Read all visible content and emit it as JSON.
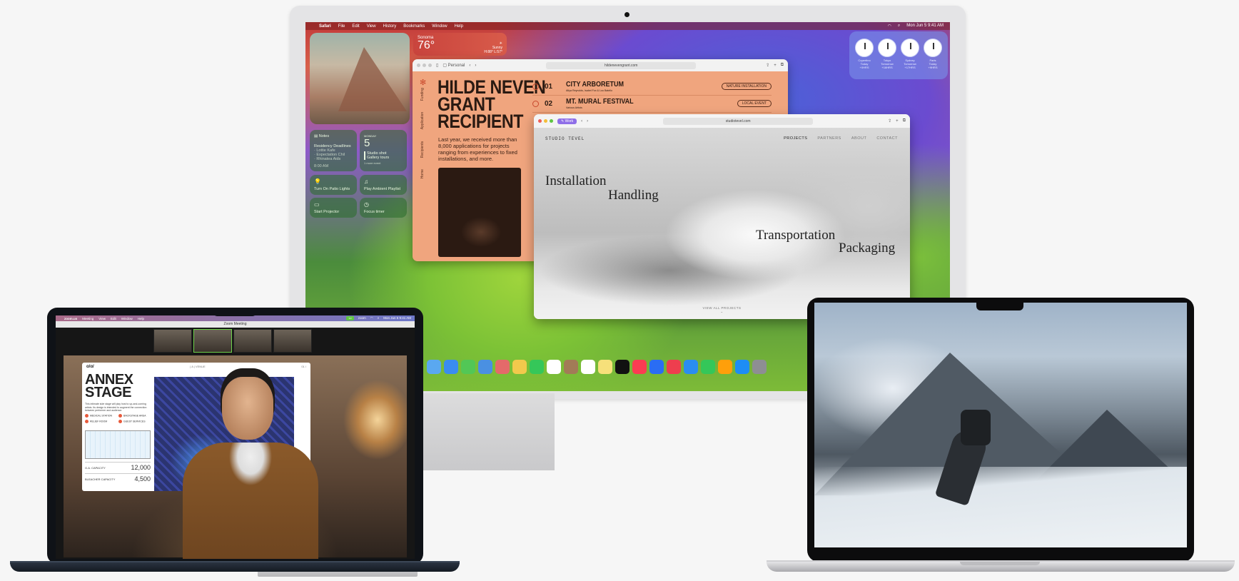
{
  "imac": {
    "menubar": {
      "apple": "",
      "app": "Safari",
      "items": [
        "File",
        "Edit",
        "View",
        "History",
        "Bookmarks",
        "Window",
        "Help"
      ],
      "clock": "Mon Jun 5  9:41 AM"
    },
    "weather": {
      "city": "Sonoma",
      "temp": "76°",
      "cond": "Sunny",
      "range": "H:88° L:57°"
    },
    "widgets": {
      "notes_title": "Notes",
      "notes_lines": [
        "Residency Deadlines",
        "· Lottie Kafe",
        "· Expectation Chil",
        "· Rhinatea Aids"
      ],
      "notes_time": "8:00 AM",
      "cal_day": "MONDAY",
      "cal_num": "5",
      "cal_events": [
        "Studio shot",
        "Gallery tours"
      ],
      "cal_more": "1 more event",
      "home": [
        "Turn On Patio Lights",
        "Play Ambient Playlist",
        "Start Projector",
        "Focus timer"
      ]
    },
    "clocks": [
      {
        "city": "Cupertino",
        "day": "Today",
        "offset": "+0HRS"
      },
      {
        "city": "Tokyo",
        "day": "Tomorrow",
        "offset": "+16HRS"
      },
      {
        "city": "Sydney",
        "day": "Tomorrow",
        "offset": "+17HRS"
      },
      {
        "city": "Paris",
        "day": "Today",
        "offset": "+9HRS"
      }
    ],
    "win1": {
      "profile": "Personal",
      "url": "hildenevengrant.com",
      "heading": [
        "HILDE NEVEN",
        "GRANT",
        "RECIPIENT"
      ],
      "side_tabs": [
        "Home",
        "Recipients",
        "Application",
        "Funding"
      ],
      "body": "Last year, we received more than 8,000 applications for projects ranging from experiences to fixed installations, and more.",
      "events": [
        {
          "num": "01",
          "title": "CITY ARBORETUM",
          "sub": "Atlya Reynolds, Isabel Fox & Lou Batello",
          "tag": "NATURE INSTALLATION"
        },
        {
          "num": "02",
          "title": "MT. MURAL FESTIVAL",
          "sub": "Various Artists",
          "tag": "LOCAL EVENT"
        }
      ]
    },
    "win2": {
      "profile": "Work",
      "url": "studiotevel.com",
      "logo": "STUDIO TEVEL",
      "nav": [
        "PROJECTS",
        "PARTNERS",
        "ABOUT",
        "CONTACT"
      ],
      "words": [
        "Installation",
        "Handling",
        "Transportation",
        "Packaging"
      ],
      "view_all": "VIEW ALL PROJECTS",
      "chevron": "⌄"
    },
    "dock_colors": [
      "#5aa8f0",
      "#3a8cf0",
      "#52c756",
      "#4a90e2",
      "#e46a6a",
      "#f2c94c",
      "#35c759",
      "#ffffff",
      "#a27b57",
      "#ffffff",
      "#f6e07a",
      "#111111",
      "#fb3c52",
      "#2a6df4",
      "#ee3e4e",
      "#2a8df1",
      "#34c759",
      "#ff9f0a",
      "#1d8df5",
      "#8e8e93"
    ]
  },
  "air": {
    "menubar": {
      "app": "zoom.us",
      "items": [
        "Meeting",
        "View",
        "Edit",
        "Window",
        "Help"
      ],
      "status": "zoom",
      "clock": "Mon Jun 5  9:41 AM"
    },
    "window_title": "Zoom Meeting",
    "slide": {
      "logo": "ɑ/ɑ/",
      "nav": "| A | VENUE",
      "page": "01 /",
      "title": [
        "ANNEX",
        "STAGE"
      ],
      "body": "This intimate side stage will play host to up-and-coming artists. Its design is intended to augment the connection between performer and audience.",
      "legend": [
        "MEDICAL STATION",
        "BACKSTAGE AREA",
        "RELIEF ROOM",
        "GUEST SERVICES"
      ],
      "caps": [
        {
          "label": "G.A. CAPACITY",
          "value": "12,000"
        },
        {
          "label": "BLEACHER CAPACITY",
          "value": "4,500"
        }
      ]
    }
  }
}
